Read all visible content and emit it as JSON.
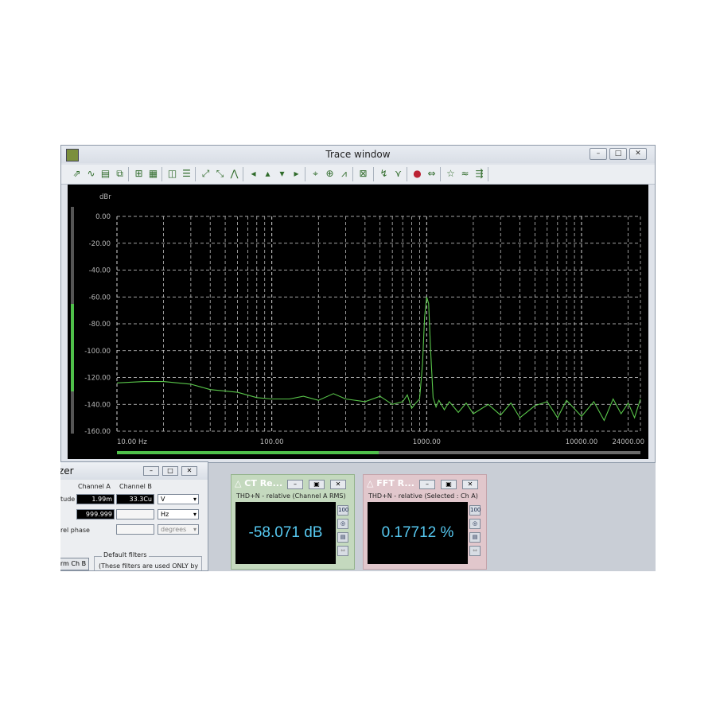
{
  "trace_window": {
    "title": "Trace window",
    "window_buttons": [
      "–",
      "□",
      "✕"
    ]
  },
  "chart_data": {
    "type": "line",
    "y_unit": "dBr",
    "y_ticks": [
      "0.00",
      "-20.00",
      "-40.00",
      "-60.00",
      "-80.00",
      "-100.00",
      "-120.00",
      "-140.00",
      "-160.00"
    ],
    "x_ticks": [
      "10.00 Hz",
      "100.00",
      "1000.00",
      "10000.00",
      "24000.00"
    ],
    "x_scale": "log",
    "xlim": [
      10,
      24000
    ],
    "ylim": [
      -160,
      0
    ],
    "grid": true,
    "color": "#59c64a",
    "series": [
      {
        "x": [
          10,
          15,
          20,
          30,
          40,
          60,
          80,
          100,
          130,
          160,
          200,
          250,
          300,
          400,
          500,
          600,
          700,
          750,
          800,
          850,
          900,
          940,
          970,
          1000,
          1030,
          1060,
          1100,
          1150,
          1200,
          1300,
          1400,
          1600,
          1800,
          2000,
          2500,
          3000,
          3500,
          4000,
          5000,
          6000,
          7000,
          8000,
          10000,
          12000,
          14000,
          16000,
          18000,
          20000,
          22000,
          24000
        ],
        "y": [
          -124,
          -123,
          -123,
          -125,
          -129,
          -131,
          -135,
          -136,
          -136,
          -134,
          -137,
          -132,
          -136,
          -138,
          -134,
          -140,
          -138,
          -133,
          -143,
          -139,
          -136,
          -110,
          -75,
          -60,
          -65,
          -100,
          -135,
          -142,
          -137,
          -144,
          -138,
          -146,
          -139,
          -147,
          -140,
          -148,
          -139,
          -150,
          -141,
          -138,
          -150,
          -137,
          -149,
          -138,
          -152,
          -136,
          -147,
          -139,
          -150,
          -136
        ]
      }
    ]
  },
  "analyzer_panel": {
    "title_fragment": "zer",
    "col_a": "Channel A",
    "col_b": "Channel B",
    "row1_label": "tude",
    "amp_a": "1.99m",
    "amp_b": "33.3Cu",
    "amp_unit": "V",
    "freq_a": "999.999",
    "freq_unit": "Hz",
    "phase_label": "rel phase",
    "phase_unit": "degrees",
    "button": "rm Ch B",
    "group_title": "Default filters",
    "group_text": "(These filters are used ONLY by"
  },
  "meter_ct": {
    "title": "CT Re...",
    "subtitle": "THD+N - relative (Channel A RMS)",
    "value": "-58.071 dB",
    "bg": "#c4d9be"
  },
  "meter_fft": {
    "title": "FFT R...",
    "subtitle": "THD+N - relative (Selected : Ch A)",
    "value": "0.17712 %",
    "bg": "#e1c7cc"
  }
}
